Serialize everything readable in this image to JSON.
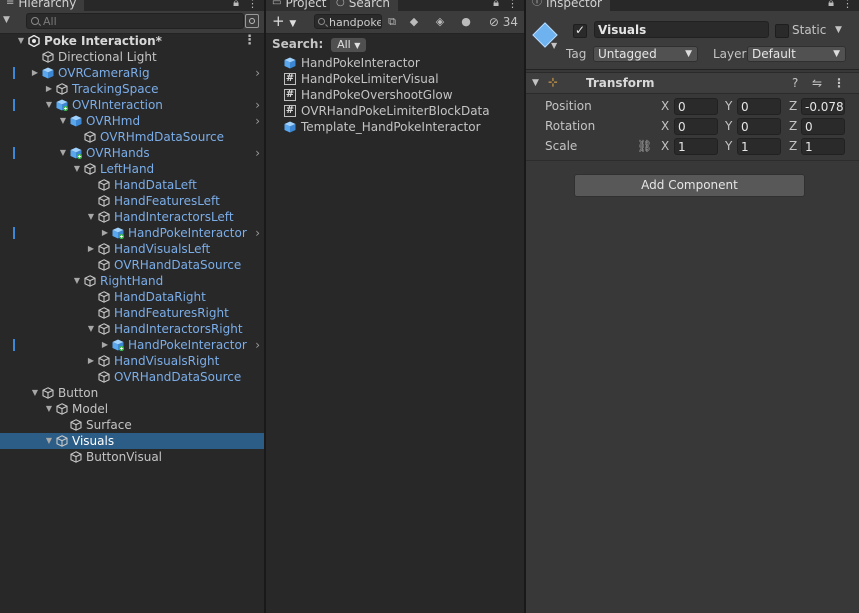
{
  "hierarchy": {
    "tab_title": "Hierarchy",
    "search_placeholder": "All",
    "items": [
      {
        "label": "Poke Interaction*",
        "depth": 0,
        "fold": "open",
        "icon": "unity-scene-icon",
        "style": "bold",
        "menu": true
      },
      {
        "label": "Directional Light",
        "depth": 1,
        "fold": "none",
        "icon": "gameobject-icon",
        "style": "normal"
      },
      {
        "label": "OVRCameraRig",
        "depth": 1,
        "fold": "closed",
        "icon": "prefab-icon",
        "style": "prefab",
        "chevron": true,
        "mark": true
      },
      {
        "label": "TrackingSpace",
        "depth": 2,
        "fold": "closed",
        "icon": "gameobject-icon",
        "style": "prefab"
      },
      {
        "label": "OVRInteraction",
        "depth": 2,
        "fold": "open",
        "icon": "prefab-added-icon",
        "style": "prefab",
        "chevron": true,
        "mark": true
      },
      {
        "label": "OVRHmd",
        "depth": 3,
        "fold": "open",
        "icon": "prefab-icon",
        "style": "prefab",
        "chevron": true
      },
      {
        "label": "OVRHmdDataSource",
        "depth": 4,
        "fold": "none",
        "icon": "gameobject-icon",
        "style": "prefab"
      },
      {
        "label": "OVRHands",
        "depth": 3,
        "fold": "open",
        "icon": "prefab-added-icon",
        "style": "prefab",
        "chevron": true,
        "mark": true
      },
      {
        "label": "LeftHand",
        "depth": 4,
        "fold": "open",
        "icon": "gameobject-icon",
        "style": "prefab"
      },
      {
        "label": "HandDataLeft",
        "depth": 5,
        "fold": "none",
        "icon": "gameobject-icon",
        "style": "prefab"
      },
      {
        "label": "HandFeaturesLeft",
        "depth": 5,
        "fold": "none",
        "icon": "gameobject-icon",
        "style": "prefab"
      },
      {
        "label": "HandInteractorsLeft",
        "depth": 5,
        "fold": "open",
        "icon": "gameobject-icon",
        "style": "prefab"
      },
      {
        "label": "HandPokeInteractor",
        "depth": 6,
        "fold": "closed",
        "icon": "prefab-added-icon",
        "style": "prefab",
        "chevron": true,
        "mark": true
      },
      {
        "label": "HandVisualsLeft",
        "depth": 5,
        "fold": "closed",
        "icon": "gameobject-icon",
        "style": "prefab"
      },
      {
        "label": "OVRHandDataSource",
        "depth": 5,
        "fold": "none",
        "icon": "gameobject-icon",
        "style": "prefab"
      },
      {
        "label": "RightHand",
        "depth": 4,
        "fold": "open",
        "icon": "gameobject-icon",
        "style": "prefab"
      },
      {
        "label": "HandDataRight",
        "depth": 5,
        "fold": "none",
        "icon": "gameobject-icon",
        "style": "prefab"
      },
      {
        "label": "HandFeaturesRight",
        "depth": 5,
        "fold": "none",
        "icon": "gameobject-icon",
        "style": "prefab"
      },
      {
        "label": "HandInteractorsRight",
        "depth": 5,
        "fold": "open",
        "icon": "gameobject-icon",
        "style": "prefab"
      },
      {
        "label": "HandPokeInteractor",
        "depth": 6,
        "fold": "closed",
        "icon": "prefab-added-icon",
        "style": "prefab",
        "chevron": true,
        "mark": true
      },
      {
        "label": "HandVisualsRight",
        "depth": 5,
        "fold": "closed",
        "icon": "gameobject-icon",
        "style": "prefab"
      },
      {
        "label": "OVRHandDataSource",
        "depth": 5,
        "fold": "none",
        "icon": "gameobject-icon",
        "style": "prefab"
      },
      {
        "label": "Button",
        "depth": 1,
        "fold": "open",
        "icon": "gameobject-icon",
        "style": "normal"
      },
      {
        "label": "Model",
        "depth": 2,
        "fold": "open",
        "icon": "gameobject-icon",
        "style": "normal"
      },
      {
        "label": "Surface",
        "depth": 3,
        "fold": "none",
        "icon": "gameobject-icon",
        "style": "normal"
      },
      {
        "label": "Visuals",
        "depth": 2,
        "fold": "open",
        "icon": "gameobject-icon",
        "style": "selected",
        "selected": true
      },
      {
        "label": "ButtonVisual",
        "depth": 3,
        "fold": "none",
        "icon": "gameobject-icon",
        "style": "normal"
      }
    ]
  },
  "project": {
    "tab_project": "Project",
    "tab_search": "Search",
    "search_value": "handpoke",
    "hidden_count": "34",
    "search_label": "Search:",
    "search_scope": "All",
    "results": [
      {
        "label": "HandPokeInteractor",
        "icon": "prefab-icon"
      },
      {
        "label": "HandPokeLimiterVisual",
        "icon": "script-icon"
      },
      {
        "label": "HandPokeOvershootGlow",
        "icon": "script-icon"
      },
      {
        "label": "OVRHandPokeLimiterBlockData",
        "icon": "script-icon"
      },
      {
        "label": "Template_HandPokeInteractor",
        "icon": "prefab-icon"
      }
    ]
  },
  "inspector": {
    "tab_title": "Inspector",
    "object_name": "Visuals",
    "active": true,
    "static_label": "Static",
    "tag_label": "Tag",
    "tag_value": "Untagged",
    "layer_label": "Layer",
    "layer_value": "Default",
    "component_title": "Transform",
    "position_label": "Position",
    "rotation_label": "Rotation",
    "scale_label": "Scale",
    "position": {
      "x": "0",
      "y": "0",
      "z": "-0.078"
    },
    "rotation": {
      "x": "0",
      "y": "0",
      "z": "0"
    },
    "scale": {
      "x": "1",
      "y": "1",
      "z": "1"
    },
    "axis_x": "X",
    "axis_y": "Y",
    "axis_z": "Z",
    "add_component_label": "Add Component",
    "colors": {
      "prefab_text": "#7bade8",
      "selection": "#2c5d87",
      "accent_mark": "#3d87d8"
    }
  }
}
